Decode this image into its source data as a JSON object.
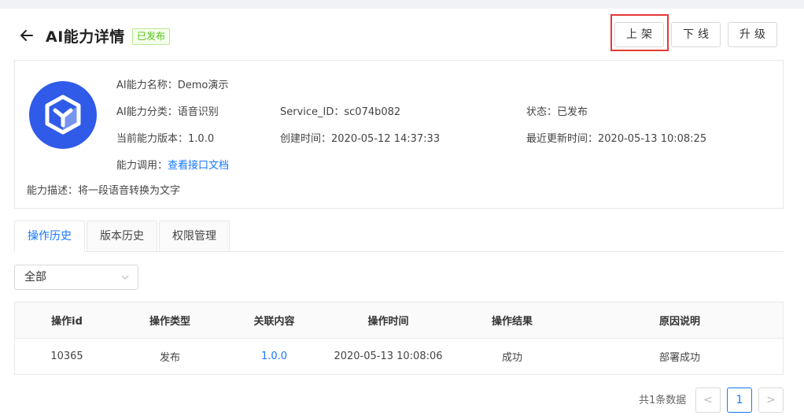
{
  "header": {
    "title": "AI能力详情",
    "status_tag": "已发布",
    "buttons": {
      "shelve": "上架",
      "offline": "下线",
      "upgrade": "升级"
    }
  },
  "info": {
    "name_label": "AI能力名称：",
    "name_value": "Demo演示",
    "category_label": "AI能力分类：",
    "category_value": "语音识别",
    "service_id_label": "Service_ID：",
    "service_id_value": "sc074b082",
    "state_label": "状态：",
    "state_value": "已发布",
    "version_label": "当前能力版本：",
    "version_value": "1.0.0",
    "created_label": "创建时间：",
    "created_value": "2020-05-12 14:37:33",
    "updated_label": "最近更新时间：",
    "updated_value": "2020-05-13 10:08:25",
    "call_label": "能力调用：",
    "call_link": "查看接口文档",
    "desc_label": "能力描述：",
    "desc_value": "将一段语音转换为文字"
  },
  "tabs": [
    {
      "label": "操作历史",
      "active": true
    },
    {
      "label": "版本历史",
      "active": false
    },
    {
      "label": "权限管理",
      "active": false
    }
  ],
  "filter": {
    "selected": "全部"
  },
  "table": {
    "columns": [
      "操作id",
      "操作类型",
      "关联内容",
      "操作时间",
      "操作结果",
      "原因说明"
    ],
    "rows": [
      [
        "10365",
        "发布",
        "1.0.0",
        "2020-05-13 10:08:06",
        "成功",
        "部署成功"
      ]
    ]
  },
  "pagination": {
    "total_text": "共1条数据",
    "current_page": "1",
    "prev": "<",
    "next": ">"
  },
  "colors": {
    "accent": "#1677ff",
    "success": "#52c41a",
    "logo": "#2f5be8",
    "highlight": "#e53935"
  }
}
